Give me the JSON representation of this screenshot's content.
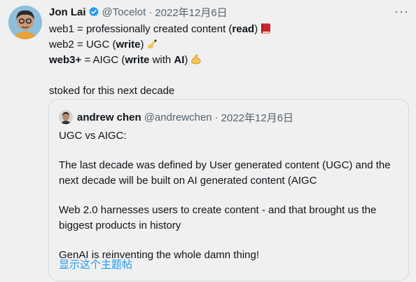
{
  "author": {
    "name": "Jon Lai",
    "handle": "@Tocelot",
    "separator": "·",
    "date": "2022年12月6日",
    "verified_icon": "verified-badge-icon"
  },
  "tweet": {
    "line1": {
      "text": "web1 = professionally created content (",
      "bold": "read",
      "tail": ")",
      "emoji": "book-icon"
    },
    "line2": {
      "text": "web2 = UGC (",
      "bold": "write",
      "tail": ")",
      "emoji": "writing-hand-icon"
    },
    "line3": {
      "bold_prefix": "web3+",
      "text": " = AIGC (",
      "bold": "write",
      "mid": " with ",
      "bold2": "AI",
      "tail": ")",
      "emoji": "flexed-biceps-icon"
    },
    "line4": "stoked for this next decade"
  },
  "quote": {
    "name": "andrew chen",
    "handle": "@andrewchen",
    "separator": "·",
    "date": "2022年12月6日",
    "p1": "UGC vs AIGC:",
    "p2": "The last decade was defined by User generated content (UGC) and the next decade will be built on AI generated content (AIGC",
    "p3": "Web 2.0 harnesses users to create content - and that brought us the biggest products in history",
    "p4": "GenAI is reinventing the whole damn thing!",
    "show_thread": "显示这个主题帖"
  },
  "more_label": "···",
  "colors": {
    "link": "#1d9bf0",
    "muted": "#536471",
    "background": "#f0f0f0",
    "border": "#cfd9de"
  }
}
